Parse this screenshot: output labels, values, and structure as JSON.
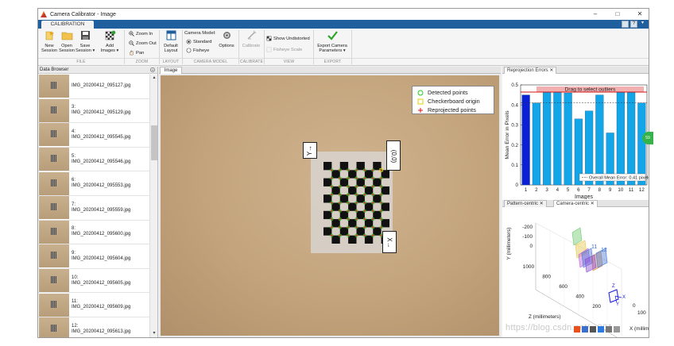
{
  "window": {
    "title": "Camera Calibrator - Image",
    "minimize": "–",
    "maximize": "□",
    "close": "✕"
  },
  "tab": {
    "label": "CALIBRATION"
  },
  "ribbon": {
    "new_session": "New\nSession",
    "open_session": "Open\nSession",
    "save_session": "Save\nSession ▾",
    "add_images": "Add\nImages ▾",
    "zoom_in": "Zoom In",
    "zoom_out": "Zoom Out",
    "pan": "Pan",
    "default_layout": "Default\nLayout",
    "camera_model": "Camera Model:",
    "standard": "Standard",
    "fisheye": "Fisheye",
    "options": "Options",
    "calibrate": "Calibrate",
    "show_undistorted": "Show Undistorted",
    "fisheye_scale": "Fisheye Scale",
    "export": "Export Camera\nParameters ▾",
    "sections": {
      "file": "FILE",
      "zoom": "ZOOM",
      "layout": "LAYOUT",
      "camera_model": "CAMERA MODEL",
      "calibrate": "CALIBRATE",
      "view": "VIEW",
      "export": "EXPORT"
    }
  },
  "browser": {
    "title": "Data Browser",
    "items": [
      {
        "label": "IMG_20200412_095127.jpg"
      },
      {
        "label": "3:\nIMG_20200412_095129.jpg"
      },
      {
        "label": "4:\nIMG_20200412_095545.jpg"
      },
      {
        "label": "5:\nIMG_20200412_095546.jpg"
      },
      {
        "label": "6:\nIMG_20200412_095553.jpg"
      },
      {
        "label": "7:\nIMG_20200412_095559.jpg"
      },
      {
        "label": "8:\nIMG_20200412_095600.jpg"
      },
      {
        "label": "9:\nIMG_20200412_095604.jpg"
      },
      {
        "label": "10:\nIMG_20200412_095605.jpg"
      },
      {
        "label": "11:\nIMG_20200412_095609.jpg"
      },
      {
        "label": "12:\nIMG_20200412_095613.jpg"
      }
    ]
  },
  "image_panel": {
    "tab": "Image",
    "legend": {
      "detected": "Detected points",
      "origin": "Checkerboard origin",
      "reprojected": "Reprojected points"
    },
    "labels": {
      "origin": "(0,0)",
      "x_axis": "X→",
      "y_axis": "Y→"
    }
  },
  "reprojection": {
    "tab": "Reprojection Errors",
    "chart_data": {
      "type": "bar",
      "categories": [
        "1",
        "2",
        "3",
        "4",
        "5",
        "6",
        "7",
        "8",
        "9",
        "10",
        "11",
        "12"
      ],
      "values": [
        0.45,
        0.41,
        0.47,
        0.48,
        0.46,
        0.33,
        0.37,
        0.45,
        0.26,
        0.47,
        0.47,
        0.41
      ],
      "selected_index": 0,
      "xlabel": "Images",
      "ylabel": "Mean Error in Pixels",
      "ylim": [
        0,
        0.5
      ],
      "yticks": [
        "0",
        "0.1",
        "0.2",
        "0.3",
        "0.4",
        "0.5"
      ],
      "banner": "Drag to select outliers",
      "mean_label": "Overall Mean Error: 0.41 pixels",
      "mean_value": 0.41,
      "colors": {
        "bar": "#12a6e8",
        "selected": "#0a1fd6",
        "banner": "#f3b0b0",
        "banner_line": "#d01010"
      }
    }
  },
  "camera_view": {
    "tab_pattern": "Pattern-centric",
    "tab_camera": "Camera-centric",
    "y_label": "Y (millimeters)",
    "z_label": "Z (millimeters)",
    "x_label": "X (millimeters)",
    "y_ticks": [
      "-200",
      "-100",
      "0"
    ],
    "z_ticks": [
      "1000",
      "800",
      "600",
      "400",
      "200"
    ],
    "x_ticks": [
      "0",
      "100"
    ],
    "plane_labels": [
      "11",
      "12"
    ],
    "camera_axis_labels": [
      "X",
      "Y",
      "Z"
    ]
  },
  "watermark": "https://blog.csdn.net/...001"
}
